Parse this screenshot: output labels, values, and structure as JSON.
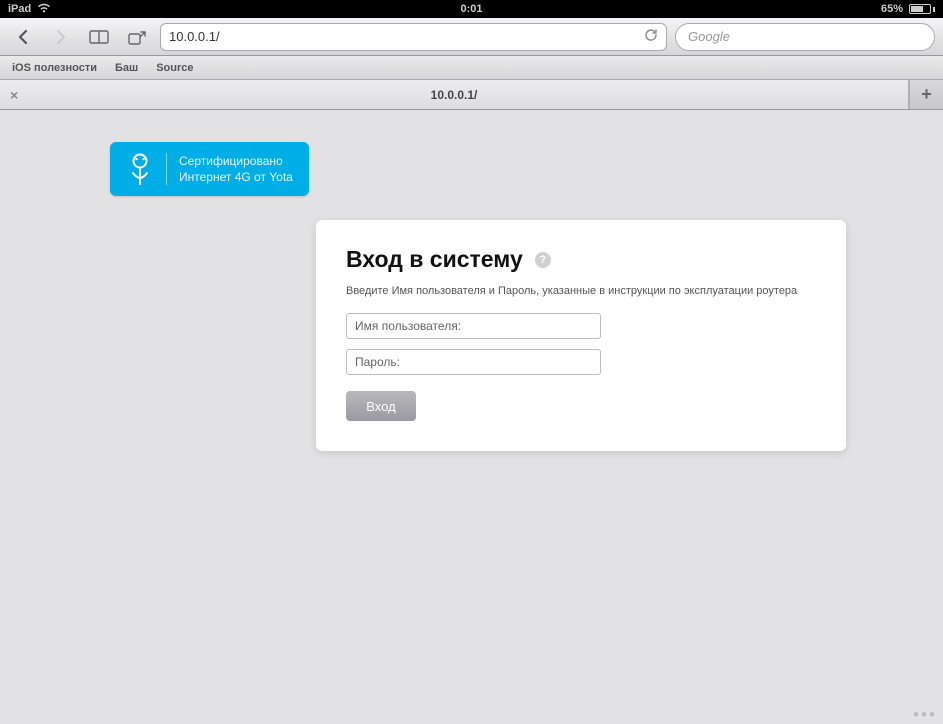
{
  "status": {
    "device": "iPad",
    "time": "0:01",
    "battery_pct": "65%"
  },
  "toolbar": {
    "url": "10.0.0.1/",
    "search_placeholder": "Google"
  },
  "bookmarks": {
    "items": [
      "iOS полезности",
      "Баш",
      "Source"
    ]
  },
  "tabs": {
    "active_title": "10.0.0.1/"
  },
  "yota": {
    "line1": "Сертифицировано",
    "line2": "Интернет 4G от Yota"
  },
  "login": {
    "title": "Вход в систему",
    "hint": "Введите Имя пользователя и Пароль, указанные в инструкции по эксплуатации роутера",
    "username_placeholder": "Имя пользователя:",
    "password_placeholder": "Пароль:",
    "submit_label": "Вход"
  }
}
